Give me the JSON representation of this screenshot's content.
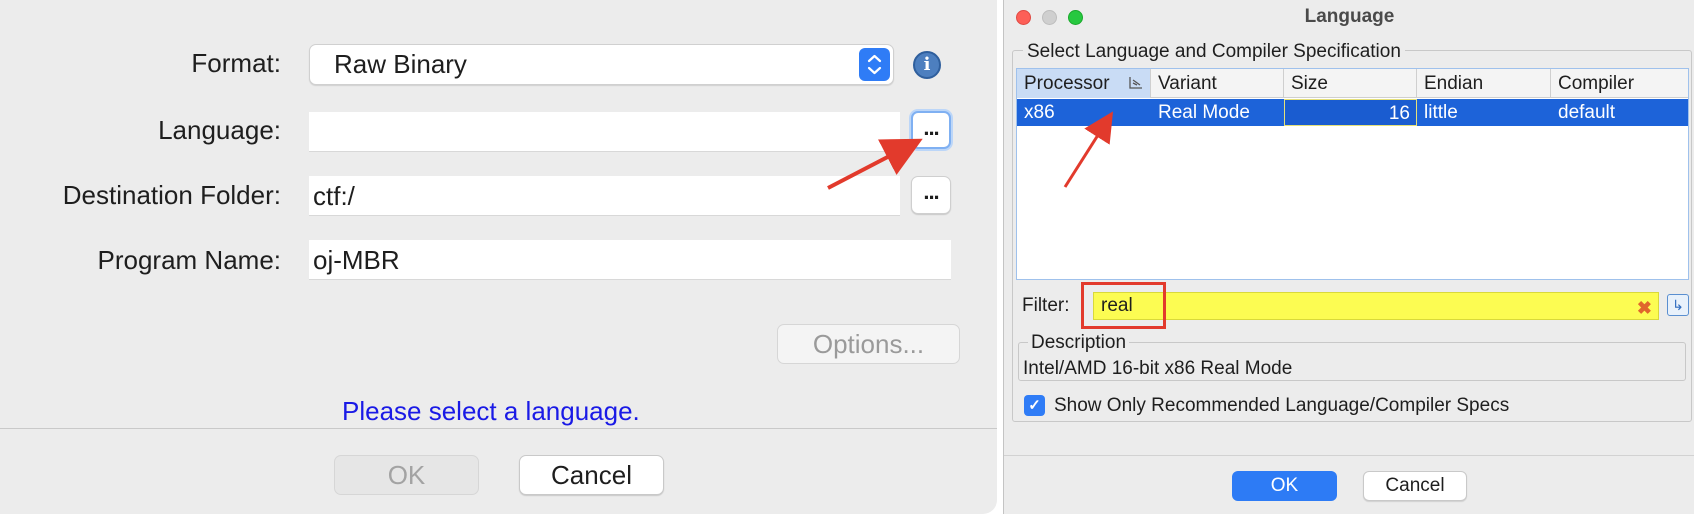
{
  "import_dialog": {
    "format_label": "Format:",
    "format_value": "Raw Binary",
    "language_label": "Language:",
    "language_value": "",
    "destination_label": "Destination Folder:",
    "destination_value": "ctf:/",
    "program_name_label": "Program Name:",
    "program_name_value": "oj-MBR",
    "browse_label": "...",
    "options_label": "Options...",
    "status_message": "Please select a language.",
    "ok_label": "OK",
    "cancel_label": "Cancel"
  },
  "language_dialog": {
    "title": "Language",
    "group_title": "Select Language and Compiler Specification",
    "columns": [
      "Processor",
      "Variant",
      "Size",
      "Endian",
      "Compiler"
    ],
    "rows": [
      [
        "x86",
        "Real Mode",
        "16",
        "little",
        "default"
      ]
    ],
    "filter_label": "Filter:",
    "filter_value": "real",
    "description_title": "Description",
    "description_text": "Intel/AMD 16-bit x86 Real Mode",
    "recommended_label": "Show Only Recommended Language/Compiler Specs",
    "recommended_checked": true,
    "ok_label": "OK",
    "cancel_label": "Cancel"
  },
  "colors": {
    "accent": "#2d7bf5",
    "selection": "#1d63d9",
    "filter_highlight": "#fcfc52",
    "annotation_red": "#e23a2c",
    "link_blue": "#1a1ae6"
  },
  "icons": {
    "info": "info-icon",
    "stepper": "chevron-updown-icon",
    "sort": "sort-icon",
    "clear": "clear-filter-icon",
    "apply": "apply-filter-icon",
    "check": "checkmark-icon"
  }
}
